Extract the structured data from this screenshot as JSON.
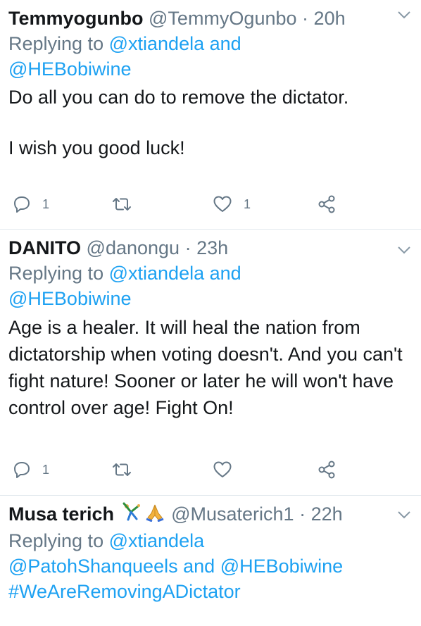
{
  "tweets": [
    {
      "name": "Temmyogunbo",
      "handle": "@TemmyOgunbo",
      "sep": "·",
      "time": "20h",
      "replying_prefix": "Replying to",
      "replying_links": [
        "@xtiandela",
        "@HEBobiwine"
      ],
      "replying_and": "and",
      "body_lines": [
        "Do all you can do to remove the dictator.",
        "I wish you good luck!"
      ],
      "reply_count": "1",
      "retweet_count": "",
      "like_count": "1"
    },
    {
      "name": "DANITO",
      "handle": "@danongu",
      "sep": "·",
      "time": "23h",
      "replying_prefix": "Replying to",
      "replying_links": [
        "@xtiandela",
        "@HEBobiwine"
      ],
      "replying_and": "and",
      "body_text": "Age is a healer. It will heal the nation from dictatorship when voting doesn't. And you can't fight nature! Sooner or later he will won't have control over age! Fight On!",
      "reply_count": "1",
      "retweet_count": "",
      "like_count": ""
    },
    {
      "name": "Musa terich",
      "name_emojis": [
        "person-cartwheeling-icon",
        "folded-hands-icon"
      ],
      "handle": "@Musaterich1",
      "sep": "·",
      "time": "22h",
      "replying_prefix": "Replying to",
      "replying_links": [
        "@xtiandela",
        "@PatohShanqueels",
        "@HEBobiwine"
      ],
      "replying_and": "and",
      "hashtag": "#WeAreRemovingADictator"
    }
  ],
  "colors": {
    "text": "#14171a",
    "muted": "#657786",
    "link": "#1da1f2",
    "divider": "#e1e8ed"
  }
}
